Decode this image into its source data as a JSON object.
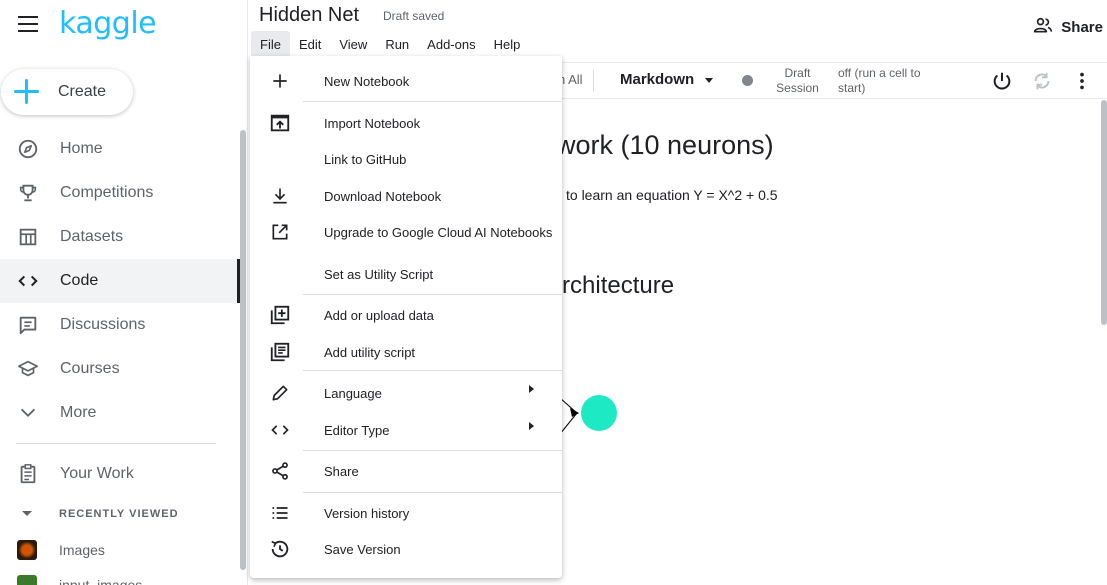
{
  "brand": {
    "logo_text": "kaggle",
    "accent_color": "#20beff"
  },
  "sidebar": {
    "create_label": "Create",
    "items": [
      {
        "label": "Home",
        "icon": "compass-icon",
        "active": false
      },
      {
        "label": "Competitions",
        "icon": "trophy-icon",
        "active": false
      },
      {
        "label": "Datasets",
        "icon": "table-icon",
        "active": false
      },
      {
        "label": "Code",
        "icon": "code-icon",
        "active": true
      },
      {
        "label": "Discussions",
        "icon": "comment-icon",
        "active": false
      },
      {
        "label": "Courses",
        "icon": "school-icon",
        "active": false
      },
      {
        "label": "More",
        "icon": "chevron-down-icon",
        "active": false
      }
    ],
    "your_work": "Your Work",
    "recently_viewed_heading": "RECENTLY VIEWED",
    "recent": [
      {
        "label": "Images"
      },
      {
        "label": "input_images"
      }
    ]
  },
  "header": {
    "title": "Hidden Net",
    "status": "Draft saved",
    "share_label": "Share",
    "menu": [
      "File",
      "Edit",
      "View",
      "Run",
      "Add-ons",
      "Help"
    ]
  },
  "toolbar": {
    "run_all_partial": "n All",
    "cell_type": "Markdown",
    "session_label": "Draft Session",
    "session_status": "off (run a cell to start)"
  },
  "notebook": {
    "heading1_partial": "work (10 neurons)",
    "paragraph_partial": "to learn an equation Y = X^2 + 0.5",
    "heading2_partial": "k architecture",
    "node_color": "#1de9c4"
  },
  "file_menu": {
    "items": [
      {
        "label": "New Notebook",
        "icon": "plus-icon"
      },
      {
        "label": "Import Notebook",
        "icon": "upload-icon"
      },
      {
        "label": "Link to GitHub",
        "icon": ""
      },
      {
        "label": "Download Notebook",
        "icon": "download-icon"
      },
      {
        "label": "Upgrade to Google Cloud AI Notebooks",
        "icon": "open-in-new-icon"
      },
      {
        "label": "Set as Utility Script",
        "icon": ""
      },
      {
        "label": "Add or upload data",
        "icon": "add-box-icon"
      },
      {
        "label": "Add utility script",
        "icon": "library-books-icon"
      },
      {
        "label": "Language",
        "icon": "pencil-icon",
        "submenu": true
      },
      {
        "label": "Editor Type",
        "icon": "code-icon",
        "submenu": true
      },
      {
        "label": "Share",
        "icon": "share-icon"
      },
      {
        "label": "Version history",
        "icon": "list-icon"
      },
      {
        "label": "Save Version",
        "icon": "history-icon"
      }
    ]
  }
}
